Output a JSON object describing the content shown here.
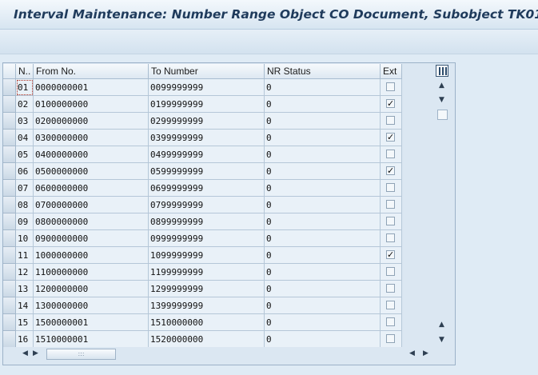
{
  "title": "Interval Maintenance: Number Range Object CO Document, Subobject TK01",
  "table": {
    "columns": [
      "N..",
      "From No.",
      "To Number",
      "NR Status",
      "Ext"
    ],
    "rows": [
      {
        "n": "01",
        "from": "0000000001",
        "to": "0099999999",
        "status": "0",
        "ext": false
      },
      {
        "n": "02",
        "from": "0100000000",
        "to": "0199999999",
        "status": "0",
        "ext": true
      },
      {
        "n": "03",
        "from": "0200000000",
        "to": "0299999999",
        "status": "0",
        "ext": false
      },
      {
        "n": "04",
        "from": "0300000000",
        "to": "0399999999",
        "status": "0",
        "ext": true
      },
      {
        "n": "05",
        "from": "0400000000",
        "to": "0499999999",
        "status": "0",
        "ext": false
      },
      {
        "n": "06",
        "from": "0500000000",
        "to": "0599999999",
        "status": "0",
        "ext": true
      },
      {
        "n": "07",
        "from": "0600000000",
        "to": "0699999999",
        "status": "0",
        "ext": false
      },
      {
        "n": "08",
        "from": "0700000000",
        "to": "0799999999",
        "status": "0",
        "ext": false
      },
      {
        "n": "09",
        "from": "0800000000",
        "to": "0899999999",
        "status": "0",
        "ext": false
      },
      {
        "n": "10",
        "from": "0900000000",
        "to": "0999999999",
        "status": "0",
        "ext": false
      },
      {
        "n": "11",
        "from": "1000000000",
        "to": "1099999999",
        "status": "0",
        "ext": true
      },
      {
        "n": "12",
        "from": "1100000000",
        "to": "1199999999",
        "status": "0",
        "ext": false
      },
      {
        "n": "13",
        "from": "1200000000",
        "to": "1299999999",
        "status": "0",
        "ext": false
      },
      {
        "n": "14",
        "from": "1300000000",
        "to": "1399999999",
        "status": "0",
        "ext": false
      },
      {
        "n": "15",
        "from": "1500000001",
        "to": "1510000000",
        "status": "0",
        "ext": false
      },
      {
        "n": "16",
        "from": "1510000001",
        "to": "1520000000",
        "status": "0",
        "ext": false
      }
    ]
  },
  "icons": {
    "config": "table-settings-icon",
    "up": "scroll-up-icon",
    "down": "scroll-down-icon",
    "left": "scroll-left-icon",
    "right": "scroll-right-icon"
  },
  "colors": {
    "background": "#dfebf5",
    "title_text": "#1f3b5c",
    "grid_line": "#b5c7d8"
  }
}
